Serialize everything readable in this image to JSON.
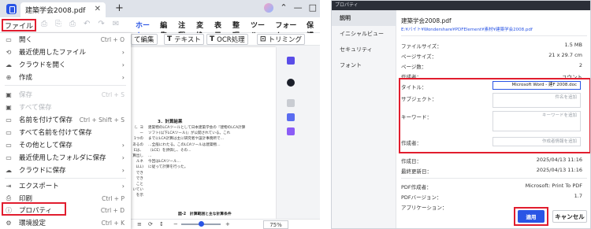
{
  "app": {
    "tab_title": "建築学会2008.pdf",
    "tab_close": "✕",
    "new_tab": "+",
    "window_controls": [
      "⌃",
      "—",
      "□"
    ],
    "file_menu": "ファイル",
    "quick_tools": [
      "⎙",
      "⎘",
      "⎙",
      "↶",
      "↷",
      "✉"
    ],
    "menus": [
      "ホーム",
      "編集",
      "注釈",
      "変換",
      "表示",
      "整理",
      "ツール",
      "フォーム",
      "保護"
    ],
    "ribbon": [
      {
        "icon": "",
        "label": "て編集"
      },
      {
        "icon": "T",
        "label": "テキスト"
      },
      {
        "icon": "T",
        "label": "OCR処理"
      },
      {
        "icon": "⊡",
        "label": "トリミング"
      }
    ],
    "zoom": "75%",
    "page_nav": [
      "≡",
      "⟳",
      "↕"
    ],
    "zoom_minus": "−",
    "zoom_plus": "+"
  },
  "doc": {
    "section_title": "3．計算結果",
    "left_column": [
      "〔、ヨー",
      "1つの",
      "あるの",
      "Eは、",
      "算出し",
      "ルネ",
      "LLL)",
      "でき",
      "でき",
      "こと",
      "いてい",
      "を示"
    ],
    "paragraph": [
      "建築物のLCAツールとして日本建築学会の『建物のLCA計算",
      "ソフト(以下LCAツール)』が公開されている。これ",
      "までにLCA計算は主に研究者や設計事務所で…",
      "…全般にわたる。このLCAツールは建築物…",
      "（LCE）を評価し、その…",
      "…",
      "今回はLCAツール…",
      "に従って計算を行った。"
    ],
    "figure_caption": "図-2　計算範囲と主な計算条件"
  },
  "file_menu": {
    "items": [
      {
        "icon": "▭",
        "label": "開く",
        "shortcut": "Ctrl + O",
        "arrow": "",
        "disabled": false
      },
      {
        "icon": "⟲",
        "label": "最近使用したファイル",
        "shortcut": "",
        "arrow": "›",
        "disabled": false
      },
      {
        "icon": "☁",
        "label": "クラウドを開く",
        "shortcut": "",
        "arrow": "›",
        "disabled": false
      },
      {
        "icon": "⊕",
        "label": "作成",
        "shortcut": "",
        "arrow": "›",
        "disabled": false
      },
      {
        "icon": "▣",
        "label": "保存",
        "shortcut": "Ctrl + S",
        "arrow": "",
        "disabled": true
      },
      {
        "icon": "▣",
        "label": "すべて保存",
        "shortcut": "",
        "arrow": "",
        "disabled": true
      },
      {
        "icon": "▭",
        "label": "名前を付けて保存",
        "shortcut": "Ctrl + Shift + S",
        "arrow": "",
        "disabled": false
      },
      {
        "icon": "▭",
        "label": "すべて名前を付けて保存",
        "shortcut": "",
        "arrow": "",
        "disabled": false
      },
      {
        "icon": "▭",
        "label": "その他として保存",
        "shortcut": "",
        "arrow": "›",
        "disabled": false
      },
      {
        "icon": "▭",
        "label": "最近使用したフォルダに保存",
        "shortcut": "",
        "arrow": "›",
        "disabled": false
      },
      {
        "icon": "☁",
        "label": "クラウドに保存",
        "shortcut": "",
        "arrow": "›",
        "disabled": false
      },
      {
        "icon": "⇥",
        "label": "エクスポート",
        "shortcut": "",
        "arrow": "›",
        "disabled": false
      },
      {
        "icon": "⎙",
        "label": "印刷",
        "shortcut": "Ctrl + P",
        "arrow": "",
        "disabled": false
      },
      {
        "icon": "ⓘ",
        "label": "プロパティ",
        "shortcut": "Ctrl + D",
        "arrow": "",
        "disabled": false
      },
      {
        "icon": "⚙",
        "label": "環境設定",
        "shortcut": "Ctrl + K",
        "arrow": "",
        "disabled": false
      }
    ]
  },
  "dialog": {
    "title": "プロパティ",
    "nav": [
      "説明",
      "イニシャルビュー",
      "セキュリティ",
      "フォント"
    ],
    "file_name": "建築学会2008.pdf",
    "file_path": "E:¥バイト¥Wondershare¥PDFElement¥素材¥建築学会2008.pdf",
    "file_size_label": "ファイルサイズ：",
    "file_size": "1.5 MB",
    "page_size_label": "ページサイズ：",
    "page_size": "21 x 29.7 cm",
    "pages_label": "ページ数：",
    "pages": "2",
    "author_label": "作成者：",
    "author_value": "ユウント",
    "title_label": "タイトル：",
    "title_value": "Microsoft Word - 建F 2008.doc",
    "subject_label": "サブジェクト：",
    "subject_placeholder": "件名を追加",
    "keywords_label": "キーワード：",
    "keywords_placeholder": "キーワードを追加",
    "creator_label": "作成者：",
    "creator_placeholder": "作成者情報を追加",
    "created_label": "作成日：",
    "created": "2025/04/13 11:16",
    "modified_label": "最終更新日：",
    "modified": "2025/04/13 11:16",
    "producer_label": "PDF作成者：",
    "producer": "Microsoft: Print To PDF",
    "version_label": "PDFバージョン：",
    "version": "1.7",
    "application_label": "アプリケーション：",
    "application": "",
    "apply_button": "適用",
    "cancel_button": "キャンセル"
  }
}
